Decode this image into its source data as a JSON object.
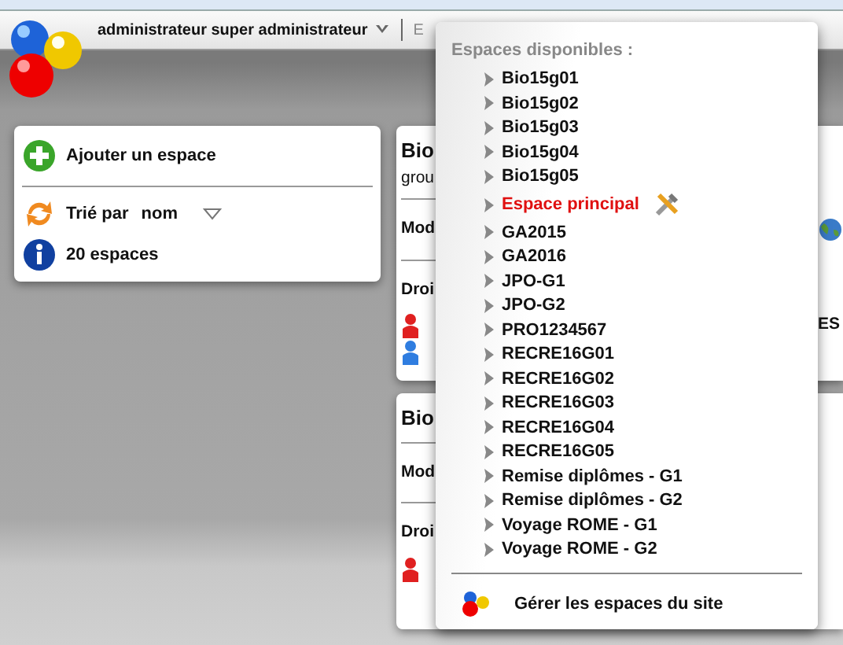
{
  "header": {
    "user": "administrateur super administrateur",
    "next_item": "E"
  },
  "left_panel": {
    "add": "Ajouter un espace",
    "sort_label": "Trié par",
    "sort_value": "nom",
    "count": "20 espaces"
  },
  "space_cards": [
    {
      "title": "Bio",
      "subtitle": "grou",
      "mode": "Mod",
      "rights": "Droi",
      "members": [
        {
          "color": "#e02020"
        },
        {
          "color": "#2f7de0"
        }
      ],
      "extra": "ES"
    },
    {
      "title": "Bio",
      "mode": "Mod",
      "rights": "Droi",
      "members": [
        {
          "color": "#e02020"
        }
      ]
    }
  ],
  "menu": {
    "heading": "Espaces disponibles :",
    "items": [
      {
        "label": "Bio15g01",
        "kind": "space"
      },
      {
        "label": "Bio15g02",
        "kind": "space"
      },
      {
        "label": "Bio15g03",
        "kind": "space"
      },
      {
        "label": "Bio15g04",
        "kind": "space"
      },
      {
        "label": "Bio15g05",
        "kind": "space"
      },
      {
        "label": "Espace principal",
        "kind": "principal"
      },
      {
        "label": "GA2015",
        "kind": "space"
      },
      {
        "label": "GA2016",
        "kind": "space"
      },
      {
        "label": "JPO-G1",
        "kind": "space"
      },
      {
        "label": "JPO-G2",
        "kind": "space"
      },
      {
        "label": "PRO1234567",
        "kind": "space"
      },
      {
        "label": "RECRE16G01",
        "kind": "space"
      },
      {
        "label": "RECRE16G02",
        "kind": "space"
      },
      {
        "label": "RECRE16G03",
        "kind": "space"
      },
      {
        "label": "RECRE16G04",
        "kind": "space"
      },
      {
        "label": "RECRE16G05",
        "kind": "space"
      },
      {
        "label": "Remise diplômes - G1",
        "kind": "space"
      },
      {
        "label": "Remise diplômes - G2",
        "kind": "space"
      },
      {
        "label": "Voyage ROME - G1",
        "kind": "space"
      },
      {
        "label": "Voyage ROME - G2",
        "kind": "space"
      }
    ],
    "footer": "Gérer les espaces du site"
  }
}
